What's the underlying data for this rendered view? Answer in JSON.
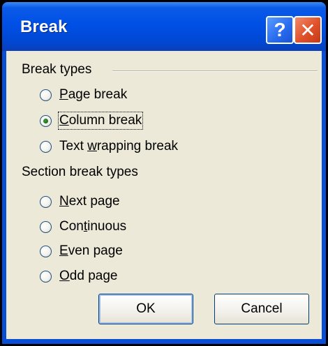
{
  "window": {
    "title": "Break",
    "help_label": "?",
    "close_label": "✕"
  },
  "break_types": {
    "label": "Break types",
    "options": [
      {
        "pre": "",
        "key": "P",
        "post": "age break",
        "checked": false
      },
      {
        "pre": "",
        "key": "C",
        "post": "olumn break",
        "checked": true
      },
      {
        "pre": "Text ",
        "key": "w",
        "post": "rapping break",
        "checked": false
      }
    ]
  },
  "section_break_types": {
    "label": "Section break types",
    "options": [
      {
        "pre": "",
        "key": "N",
        "post": "ext page",
        "checked": false
      },
      {
        "pre": "Con",
        "key": "t",
        "post": "inuous",
        "checked": false
      },
      {
        "pre": "",
        "key": "E",
        "post": "ven page",
        "checked": false
      },
      {
        "pre": "",
        "key": "O",
        "post": "dd page",
        "checked": false
      }
    ]
  },
  "buttons": {
    "ok": "OK",
    "cancel": "Cancel"
  }
}
